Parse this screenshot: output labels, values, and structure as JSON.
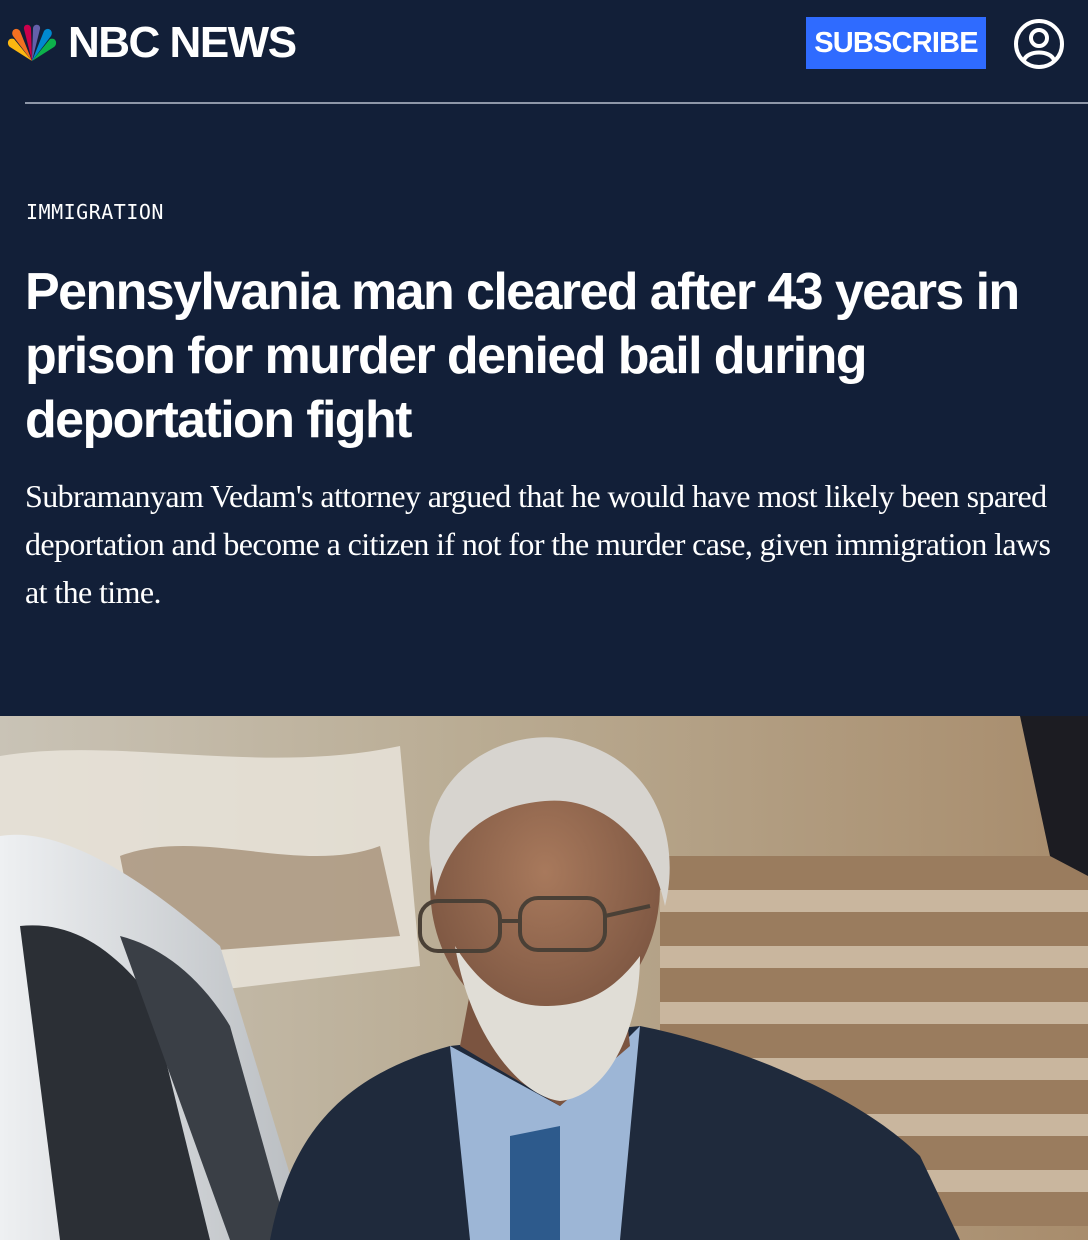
{
  "header": {
    "brand": "NBC NEWS",
    "subscribe_label": "SUBSCRIBE",
    "account_icon": "user-circle-icon",
    "logo_icon": "nbc-peacock-icon"
  },
  "article": {
    "category": "IMMIGRATION",
    "headline": "Pennsylvania man cleared after 43 years in prison for murder denied bail during deportation fight",
    "dek": "Subramanyam Vedam's attorney argued that he would have most likely been spared deportation and become a citizen if not for the murder case, given immigration laws at the time."
  },
  "colors": {
    "background": "#121f38",
    "subscribe": "#2f6bff",
    "text": "#ffffff"
  }
}
